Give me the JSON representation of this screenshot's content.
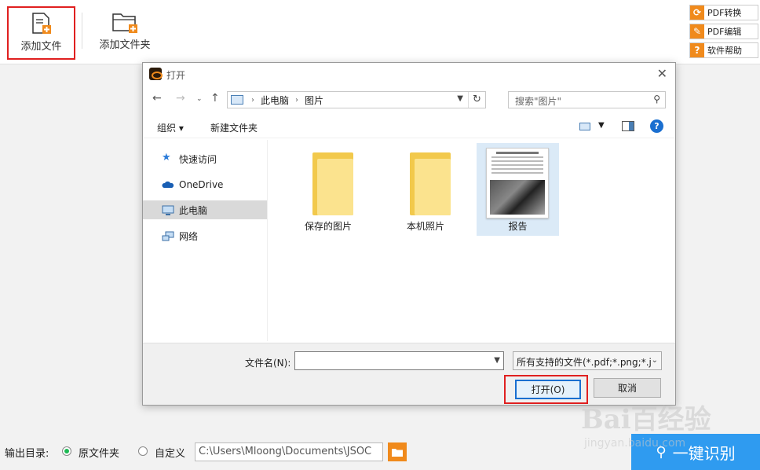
{
  "toolbar": {
    "add_file": "添加文件",
    "add_folder": "添加文件夹"
  },
  "side_buttons": {
    "pdf_convert": "PDF转换",
    "pdf_edit": "PDF编辑",
    "help": "软件帮助"
  },
  "dialog": {
    "title": "打开",
    "breadcrumb": [
      "此电脑",
      "图片"
    ],
    "search_placeholder": "搜索\"图片\"",
    "organize": "组织",
    "new_folder": "新建文件夹",
    "sidebar": [
      {
        "label": "快速访问",
        "icon": "star-icon"
      },
      {
        "label": "OneDrive",
        "icon": "cloud-icon"
      },
      {
        "label": "此电脑",
        "icon": "computer-icon",
        "selected": true
      },
      {
        "label": "网络",
        "icon": "network-icon"
      }
    ],
    "files": [
      {
        "label": "保存的图片",
        "type": "folder"
      },
      {
        "label": "本机照片",
        "type": "folder"
      },
      {
        "label": "报告",
        "type": "image",
        "selected": true
      }
    ],
    "filename_label": "文件名(N):",
    "filename_value": "",
    "filetype": "所有支持的文件(*.pdf;*.png;*.j",
    "open_button": "打开(O)",
    "cancel_button": "取消"
  },
  "bottom": {
    "output_label": "输出目录:",
    "radio_original": "原文件夹",
    "radio_custom": "自定义",
    "path": "C:\\Users\\Mloong\\Documents\\JSOC",
    "recognize": "一键识别"
  },
  "watermark": {
    "brand": "Bai百经验",
    "url": "jingyan.baidu.com"
  }
}
